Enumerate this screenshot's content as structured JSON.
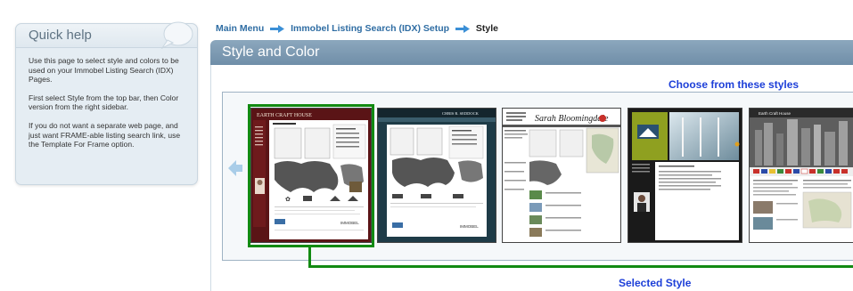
{
  "quick_help": {
    "title": "Quick help",
    "paragraphs": [
      "Use this page to select style and colors to be used on your Immobel Listing Search (IDX) Pages.",
      "First select Style from the top bar, then Color version from the right sidebar.",
      "If you do not want a separate web page, and just want FRAME-able listing search link, use the Template For Frame option."
    ]
  },
  "breadcrumb": {
    "items": [
      "Main Menu",
      "Immobel Listing Search (IDX) Setup"
    ],
    "current": "Style"
  },
  "section": {
    "title": "Style and Color",
    "choose_label": "Choose from these styles",
    "selected_label": "Selected Style"
  },
  "thumbnails": [
    {
      "header": "EARTH CRAFT HOUSE",
      "footer": "IMMOBEL",
      "selected": true
    },
    {
      "header": "CHRIS R. SEDDOCK",
      "footer": "IMMOBEL",
      "selected": false
    },
    {
      "header": "Sarah Bloomingdale",
      "selected": false
    },
    {
      "header": "",
      "selected": false
    },
    {
      "header": "Earth Craft House",
      "selected": false
    }
  ],
  "colors": {
    "accent_blue": "#1d3fd8",
    "link_blue": "#2f6da3",
    "selection_green": "#128a12",
    "section_bar": "#7b99b2"
  }
}
